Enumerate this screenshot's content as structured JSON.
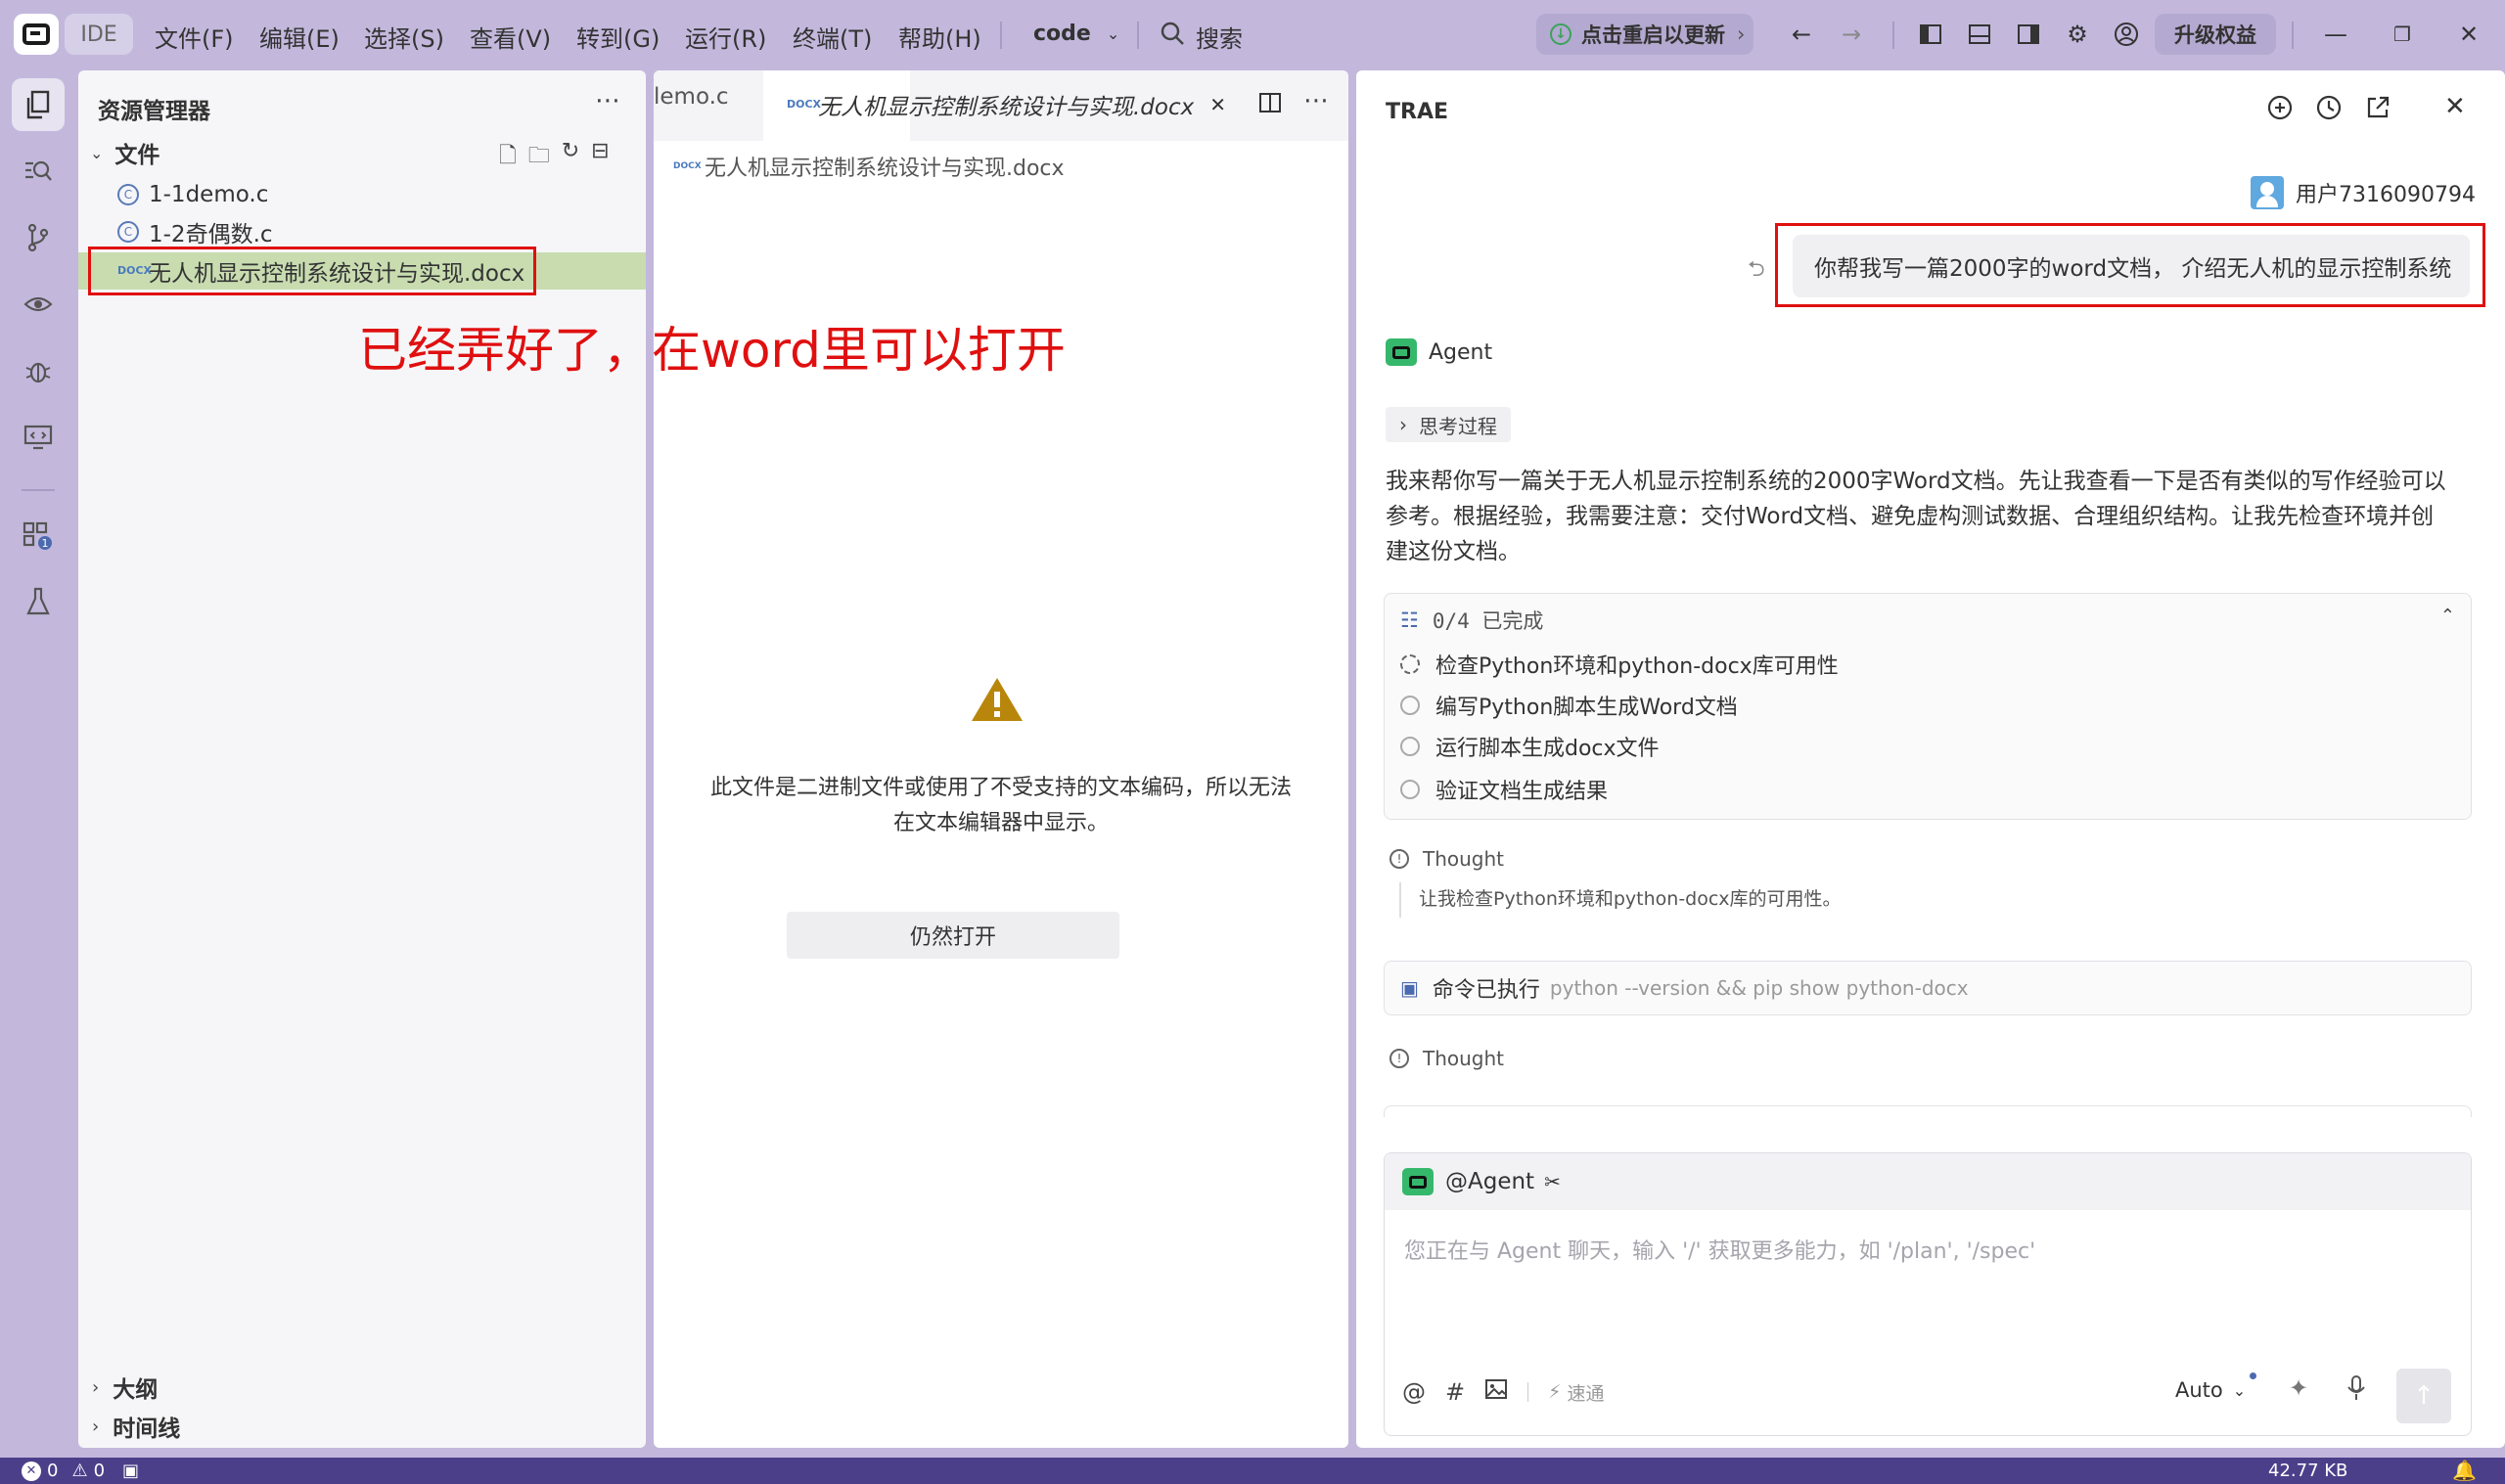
{
  "titlebar": {
    "ide_label": "IDE",
    "menus": [
      "文件(F)",
      "编辑(E)",
      "选择(S)",
      "查看(V)",
      "转到(G)",
      "运行(R)",
      "终端(T)",
      "帮助(H)"
    ],
    "workspace": "code",
    "search_label": "搜索",
    "update_label": "点击重启以更新",
    "upgrade_label": "升级权益"
  },
  "explorer": {
    "title": "资源管理器",
    "section_files": "文件",
    "files": [
      "1-1demo.c",
      "1-2奇偶数.c",
      "无人机显示控制系统设计与实现.docx"
    ],
    "annotation": "已经弄好了，在word里可以打开",
    "outline_label": "大纲",
    "timeline_label": "时间线"
  },
  "editor": {
    "tab_inactive": "lemo.c",
    "tab_active": "无人机显示控制系统设计与实现.docx",
    "breadcrumb": "无人机显示控制系统设计与实现.docx",
    "warning_line1": "此文件是二进制文件或使用了不受支持的文本编码，所以无法",
    "warning_line2": "在文本编辑器中显示。",
    "open_anyway": "仍然打开"
  },
  "chat": {
    "title": "TRAE",
    "user_name": "用户7316090794",
    "user_message": "你帮我写一篇2000字的word文档， 介绍无人机的显示控制系统",
    "agent_name": "Agent",
    "thinking_label": "思考过程",
    "response_line1": "我来帮你写一篇关于无人机显示控制系统的2000字Word文档。先让我查看一下是否有类似的写作经验可以",
    "response_line2": "参考。根据经验，我需要注意：交付Word文档、避免虚构测试数据、合理组织结构。让我先检查环境并创",
    "response_line3": "建这份文档。",
    "todo_progress": "0/4 已完成",
    "todos": [
      "检查Python环境和python-docx库可用性",
      "编写Python脚本生成Word文档",
      "运行脚本生成docx文件",
      "验证文档生成结果"
    ],
    "thought_label": "Thought",
    "thought_text": "让我检查Python环境和python-docx库的可用性。",
    "cmd_label": "命令已执行",
    "cmd_text": "python --version && pip show python-docx",
    "thought2_label": "Thought",
    "input_agent": "@Agent",
    "input_placeholder": "您正在与 Agent 聊天，输入 '/' 获取更多能力，如 '/plan', '/spec'",
    "speed_label": "速通",
    "mode_label": "Auto"
  },
  "statusbar": {
    "errors": "0",
    "warnings": "0",
    "file_size": "42.77 KB"
  },
  "colors": {
    "frame": "#c3b8dc",
    "annotation_red": "#e01010",
    "selected_row": "#c8dcb0",
    "agent_green": "#35b86b",
    "warning_gold": "#b8860b",
    "statusbar": "#4c3f8a"
  }
}
